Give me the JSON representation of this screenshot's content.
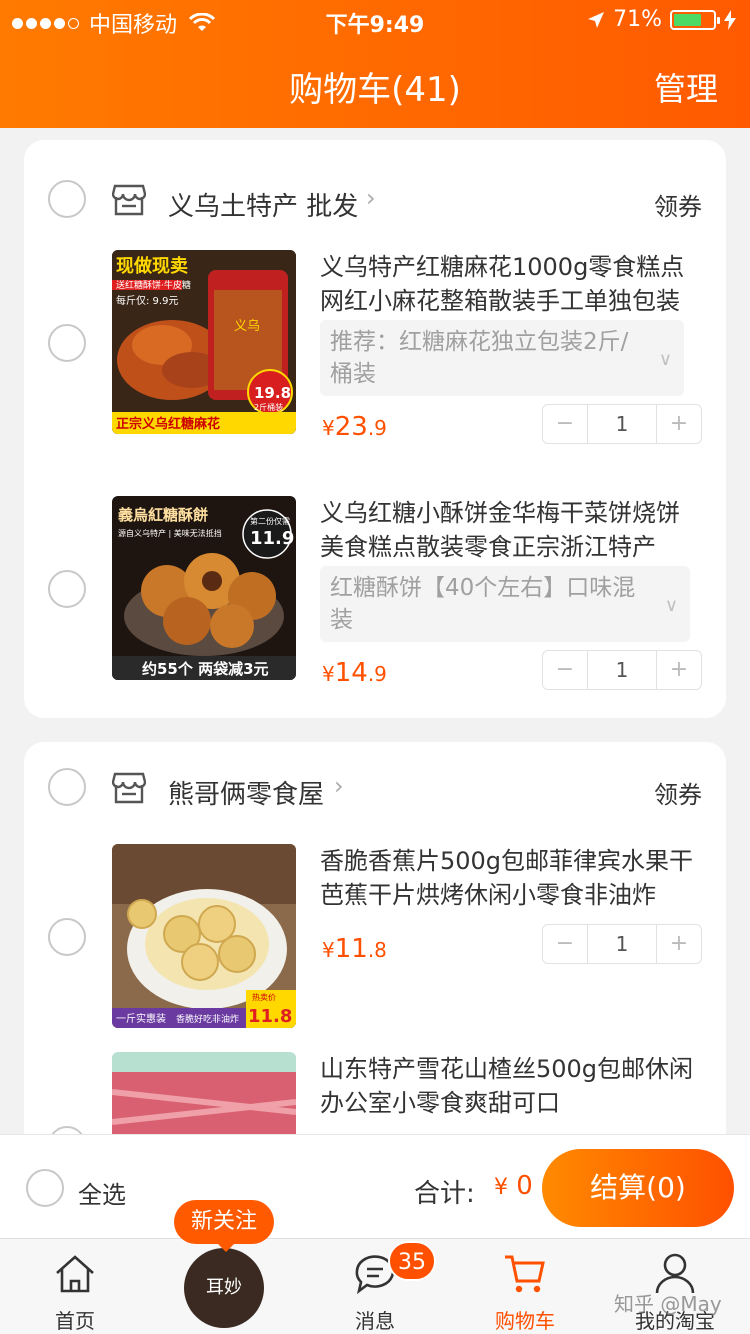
{
  "status_bar": {
    "carrier": "中国移动",
    "time": "下午9:49",
    "battery": "71%",
    "battery_level": 0.71
  },
  "nav": {
    "title": "购物车(41)",
    "manage": "管理"
  },
  "shops": [
    {
      "name": "义乌土特产 批发",
      "coupon": "领券",
      "items": [
        {
          "title": "义乌特产红糖麻花1000g零食糕点网红小麻花整箱散装手工单独包装",
          "sku": "推荐：红糖麻花独立包装2斤/桶装",
          "price_symbol": "¥",
          "price_int": "23",
          "price_dec": ".9",
          "qty": "1",
          "image_text": [
            "现做现卖",
            "送红糖酥饼·牛皮糖",
            "每斤仅: 9.9元",
            "19.8",
            "2斤桶装",
            "正宗义乌红糖麻花",
            "义乌"
          ]
        },
        {
          "title": "义乌红糖小酥饼金华梅干菜饼烧饼美食糕点散装零食正宗浙江特产",
          "sku": "红糖酥饼【40个左右】口味混装",
          "price_symbol": "¥",
          "price_int": "14",
          "price_dec": ".9",
          "qty": "1",
          "image_text": [
            "義烏紅糖酥餅",
            "第二份仅需",
            "11.9",
            "源自义乌特产 | 美味无法抵挡",
            "约55个 两袋减3元"
          ]
        }
      ]
    },
    {
      "name": "熊哥俩零食屋",
      "coupon": "领券",
      "items": [
        {
          "title": "香脆香蕉片500g包邮菲律宾水果干芭蕉干片烘烤休闲小零食非油炸",
          "sku": "",
          "price_symbol": "¥",
          "price_int": "11",
          "price_dec": ".8",
          "qty": "1",
          "image_text": [
            "热卖价",
            "11.8",
            "一斤实惠装",
            "香脆好吃非油炸"
          ]
        },
        {
          "title": "山东特产雪花山楂丝500g包邮休闲办公室小零食爽甜可口",
          "sku": "",
          "price_symbol": "",
          "price_int": "",
          "price_dec": "",
          "qty": ""
        }
      ]
    }
  ],
  "checkout": {
    "select_all": "全选",
    "total_label": "合计:",
    "total_symbol": "¥",
    "total_value": "0",
    "button": "结算(0)"
  },
  "tabbar": {
    "items": [
      {
        "label": "首页",
        "icon": "home-icon"
      },
      {
        "label": "",
        "icon": "promo-avatar"
      },
      {
        "label": "消息",
        "icon": "message-icon"
      },
      {
        "label": "购物车",
        "icon": "cart-icon"
      },
      {
        "label": "我的淘宝",
        "icon": "profile-icon"
      }
    ],
    "message_badge": "35",
    "promo_tag": "新关注",
    "promo_logo": "耳妙"
  },
  "watermark": "知乎 @May",
  "colors": {
    "brand": "#ff5000",
    "header": "#ff6a00",
    "battery": "#4cd964"
  }
}
